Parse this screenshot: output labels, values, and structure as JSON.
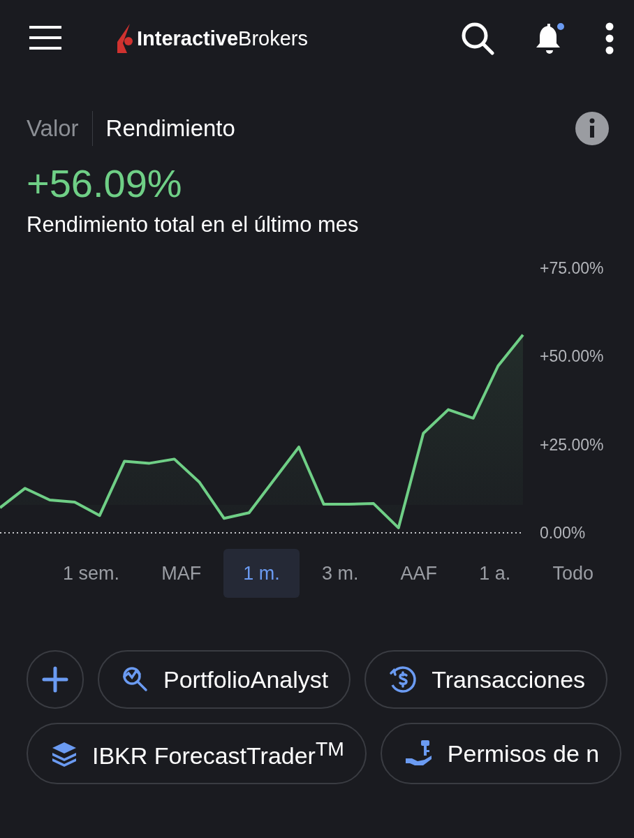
{
  "header": {
    "logo": "**Interactive**Brokers",
    "notification_dot": true
  },
  "view_toggle": [
    {
      "label": "Valor",
      "selected": false
    },
    {
      "label": "Rendimiento",
      "selected": true
    }
  ],
  "return_value": "+56.09%",
  "subtitle": "Rendimiento total en el último mes",
  "chart_data": {
    "type": "line",
    "ylim": [
      0,
      75
    ],
    "yticks": [
      {
        "value": 75,
        "label": "+75.00%"
      },
      {
        "value": 50,
        "label": "+50.00%"
      },
      {
        "value": 25,
        "label": "+25.00%"
      },
      {
        "value": 0,
        "label": "0.00%"
      }
    ],
    "series": [
      {
        "color": "#6fcf86",
        "values": [
          7.1,
          12.6,
          9.3,
          8.7,
          4.9,
          20.3,
          19.7,
          20.9,
          14.4,
          4.1,
          5.7,
          15.0,
          24.3,
          8.1,
          8.1,
          8.3,
          1.4,
          28.2,
          34.9,
          32.5,
          47.3,
          56.1
        ]
      }
    ]
  },
  "periods": [
    {
      "label": "1 sem.",
      "selected": false
    },
    {
      "label": "MAF",
      "selected": false
    },
    {
      "label": "1 m.",
      "selected": true
    },
    {
      "label": "3 m.",
      "selected": false
    },
    {
      "label": "AAF",
      "selected": false
    },
    {
      "label": "1 a.",
      "selected": false
    },
    {
      "label": "Todo",
      "selected": false
    }
  ],
  "shortcuts": [
    [
      {
        "kind": "add"
      },
      {
        "kind": "analyst",
        "label": "PortfolioAnalyst"
      },
      {
        "kind": "transactions",
        "label": "Transacciones"
      }
    ],
    [
      {
        "kind": "layers",
        "label": "IBKR ForecastTrader$^{TM}$"
      },
      {
        "kind": "permissions",
        "label": "Permisos de n"
      }
    ]
  ]
}
